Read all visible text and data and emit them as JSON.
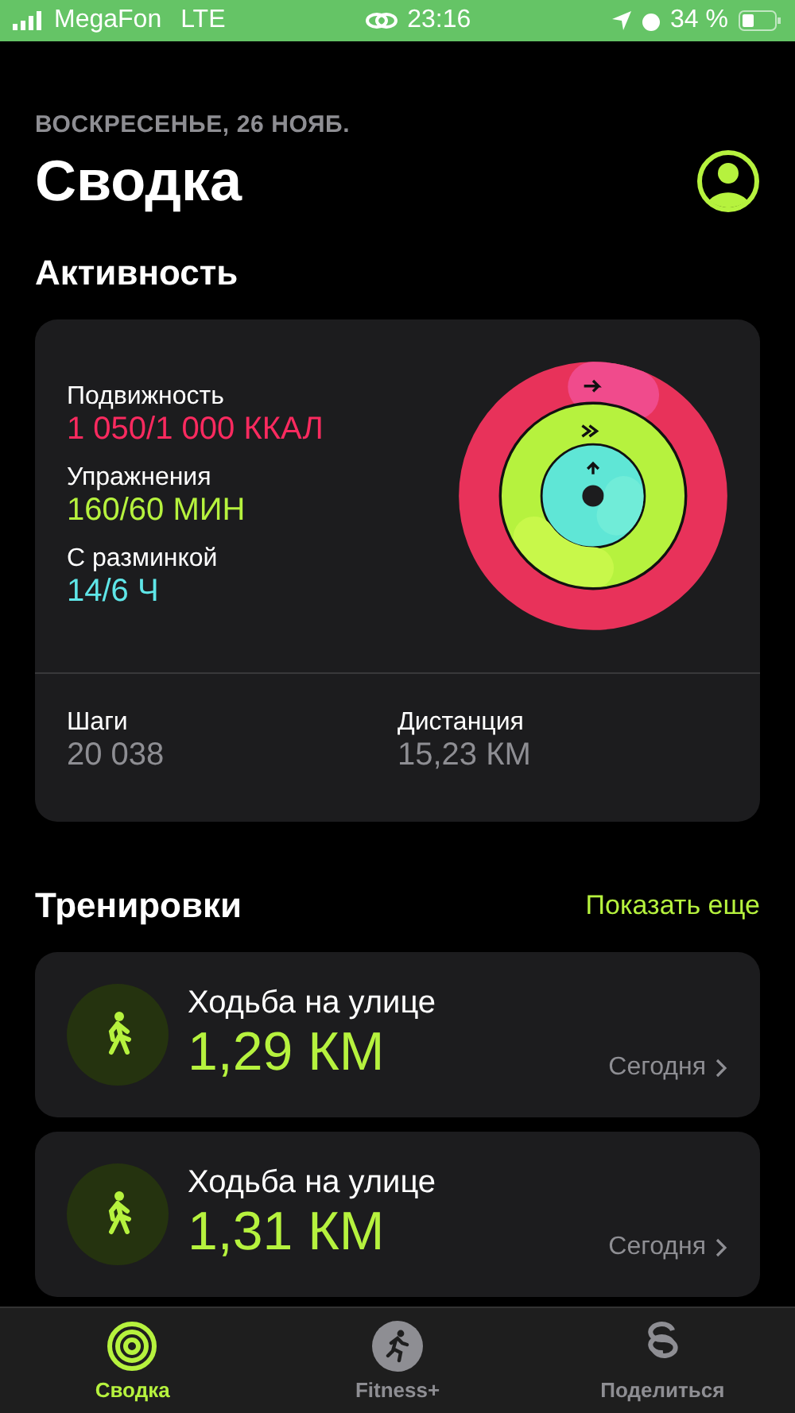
{
  "status_bar": {
    "carrier": "MegaFon",
    "network": "LTE",
    "time": "23:16",
    "battery": "34 %"
  },
  "header": {
    "date": "ВОСКРЕСЕНЬЕ, 26 НОЯБ.",
    "title": "Сводка"
  },
  "activity": {
    "heading": "Активность",
    "metrics": [
      {
        "label": "Подвижность",
        "value": "1 050/1 000 ККАЛ",
        "color": "#fa2a5f"
      },
      {
        "label": "Упражнения",
        "value": "160/60 МИН",
        "color": "#b6f23e"
      },
      {
        "label": "С разминкой",
        "value": "14/6 Ч",
        "color": "#5fe6e8"
      }
    ],
    "stats": [
      {
        "label": "Шаги",
        "value": "20 038"
      },
      {
        "label": "Дистанция",
        "value": "15,23 КМ"
      }
    ]
  },
  "workouts": {
    "heading": "Тренировки",
    "more_link": "Показать еще",
    "items": [
      {
        "name": "Ходьба на улице",
        "distance": "1,29 КМ",
        "date": "Сегодня"
      },
      {
        "name": "Ходьба на улице",
        "distance": "1,31 КМ",
        "date": "Сегодня"
      }
    ]
  },
  "tabs": [
    {
      "label": "Сводка",
      "kind": "summary",
      "selected": true
    },
    {
      "label": "Fitness+",
      "kind": "fitness",
      "selected": false
    },
    {
      "label": "Поделиться",
      "kind": "sharing",
      "selected": false
    }
  ]
}
